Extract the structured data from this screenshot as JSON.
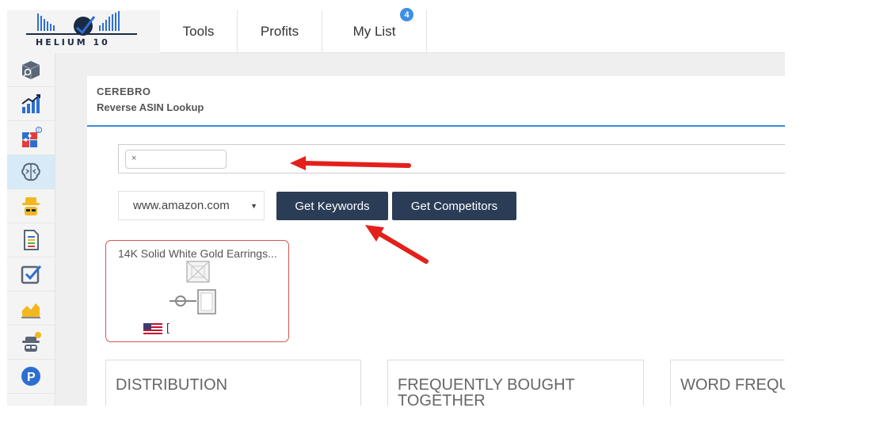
{
  "logo": {
    "text": "HELIUM 10"
  },
  "nav": {
    "tools": "Tools",
    "profits": "Profits",
    "mylist": "My List",
    "mylist_badge": "4"
  },
  "sidebar": {
    "items": [
      {
        "icon": "product-box-search-icon",
        "active": false
      },
      {
        "icon": "growth-chart-icon",
        "active": false
      },
      {
        "icon": "puzzle-pieces-icon",
        "active": false
      },
      {
        "icon": "brain-icon",
        "active": true
      },
      {
        "icon": "spy-hat-icon",
        "active": false
      },
      {
        "icon": "listing-document-icon",
        "active": false
      },
      {
        "icon": "checkbox-icon",
        "active": false
      },
      {
        "icon": "area-chart-icon",
        "active": false
      },
      {
        "icon": "alert-spy-icon",
        "active": false
      },
      {
        "icon": "parking-icon",
        "active": false
      }
    ]
  },
  "panel": {
    "title": "CEREBRO",
    "subtitle": "Reverse ASIN Lookup"
  },
  "asin_input": {
    "chip_remove": "×"
  },
  "marketplace": {
    "selected": "www.amazon.com",
    "caret": "▼"
  },
  "buttons": {
    "get_keywords": "Get Keywords",
    "get_competitors": "Get Competitors"
  },
  "product": {
    "title": "14K Solid White Gold Earrings...",
    "asin_prefix": "["
  },
  "sections": {
    "distribution": "DISTRIBUTION",
    "frequently_bought": "FREQUENTLY BOUGHT TOGETHER",
    "word_frequency": "WORD FREQUENCY"
  },
  "colors": {
    "accent_blue": "#3a8ad6",
    "button_dark": "#2b3d56",
    "card_border": "#d9534f",
    "arrow_red": "#e3201c",
    "active_sidebar": "#d6eaf8"
  }
}
